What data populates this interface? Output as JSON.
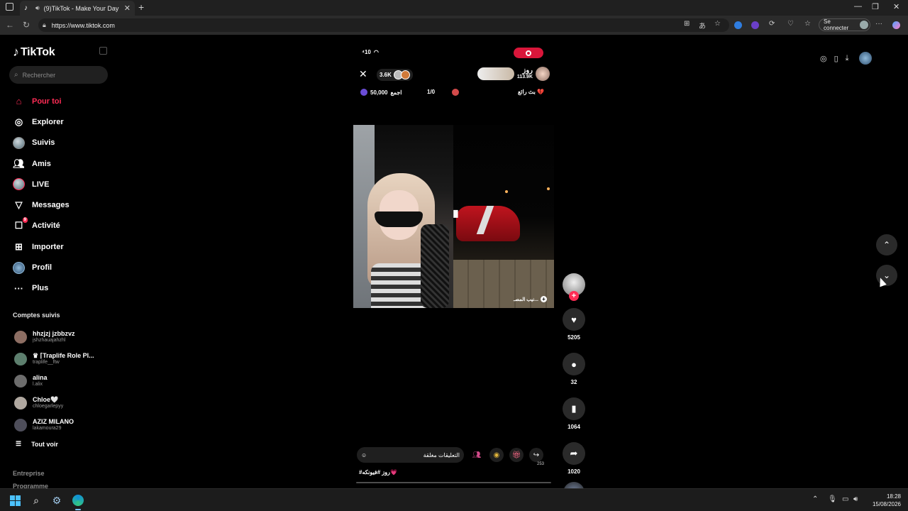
{
  "browser": {
    "tab_title": "(9)TikTok - Make Your Day",
    "url": "https://www.tiktok.com",
    "signin_label": "Se connecter"
  },
  "sidebar": {
    "logo": "TikTok",
    "search_placeholder": "Rechercher",
    "nav": [
      {
        "label": "Pour toi",
        "icon": "home-icon",
        "active": true
      },
      {
        "label": "Explorer",
        "icon": "compass-icon"
      },
      {
        "label": "Suivis",
        "icon": "following-avatar"
      },
      {
        "label": "Amis",
        "icon": "friends-icon"
      },
      {
        "label": "LIVE",
        "icon": "live-avatar"
      },
      {
        "label": "Messages",
        "icon": "send-icon"
      },
      {
        "label": "Activité",
        "icon": "activity-icon",
        "badge": "9"
      },
      {
        "label": "Importer",
        "icon": "upload-icon"
      },
      {
        "label": "Profil",
        "icon": "profile-avatar"
      },
      {
        "label": "Plus",
        "icon": "more-icon"
      }
    ],
    "followed_title": "Comptes suivis",
    "accounts": [
      {
        "name": "hhzjzj jzbbzvz",
        "handle": "jshzhauajahzhl",
        "color": "#8d6e63"
      },
      {
        "name": "♛ ⌈Traplife Role Pl...",
        "handle": "traplife__ftw",
        "color": "#5d7f6e"
      },
      {
        "name": "alina",
        "handle": "l.alix",
        "color": "#6d6d6d"
      },
      {
        "name": "Chloe🤍",
        "handle": "chloegarlepyy",
        "color": "#b0a8a0"
      },
      {
        "name": "AZIZ MILANO",
        "handle": "lakamoura29",
        "color": "#4e4e5a"
      }
    ],
    "see_all": "Tout voir",
    "footer": [
      "Entreprise",
      "Programme"
    ]
  },
  "live": {
    "status_icons": "⁴10",
    "viewer_count": "3.6K",
    "host_name": "روز",
    "host_likes": "113.9K",
    "goal_amount": "50,000",
    "goal_label": "اجمع",
    "round": "1/0",
    "host_tag": "بث رائع 💔",
    "cam_label": "نيب المصـ...",
    "comments_closed": "التعليقات مغلقة",
    "share_count": "253",
    "caption": "#روز #فيونكه💗"
  },
  "actions": {
    "likes": "5205",
    "comments": "32",
    "saves": "1064",
    "shares": "1020"
  },
  "taskbar": {
    "time": "18:28",
    "date": "15/08/2026"
  },
  "colors": {
    "accent": "#fe2c55",
    "background": "#000000",
    "surface": "#202020"
  }
}
